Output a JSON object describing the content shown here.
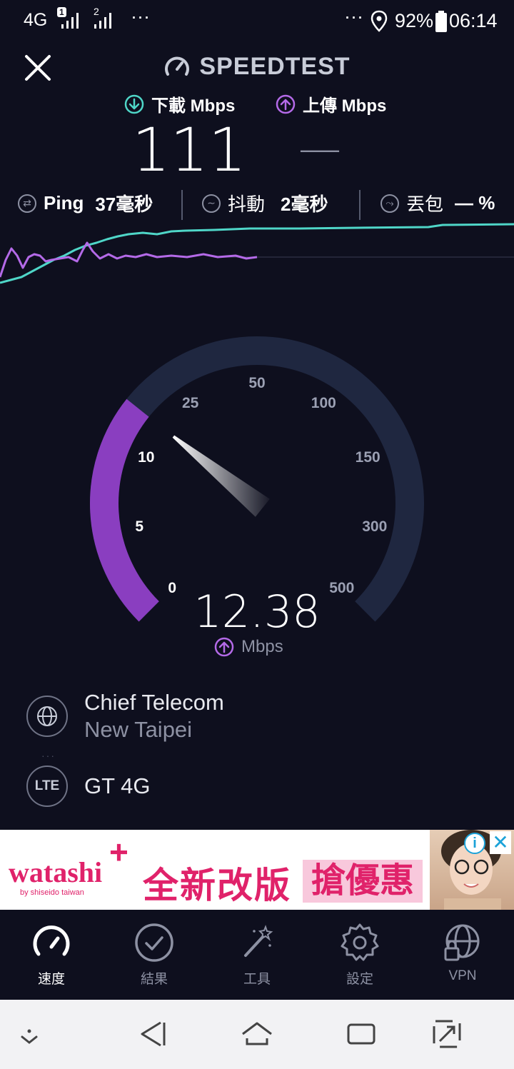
{
  "status_bar": {
    "network": "4G",
    "sim1": "1",
    "sim2": "2",
    "dots_left": "···",
    "dots_right": "···",
    "battery": "92%",
    "time": "06:14"
  },
  "header": {
    "title": "SPEEDTEST"
  },
  "download": {
    "label": "下載 Mbps",
    "value": "111"
  },
  "upload": {
    "label": "上傳 Mbps",
    "value": "—"
  },
  "metrics": {
    "ping_label": "Ping",
    "ping_value": "37毫秒",
    "jitter_label": "抖動",
    "jitter_value": "2毫秒",
    "loss_label": "丟包",
    "loss_value": "— %"
  },
  "gauge": {
    "ticks": [
      {
        "label": "0",
        "active": true
      },
      {
        "label": "5",
        "active": true
      },
      {
        "label": "10",
        "active": true
      },
      {
        "label": "25",
        "active": false
      },
      {
        "label": "50",
        "active": false
      },
      {
        "label": "100",
        "active": false
      },
      {
        "label": "150",
        "active": false
      },
      {
        "label": "300",
        "active": false
      },
      {
        "label": "500",
        "active": false
      }
    ],
    "value": "12.38",
    "unit": "Mbps",
    "level_fraction": 0.31
  },
  "server": {
    "provider": "Chief Telecom",
    "location": "New Taipei"
  },
  "connection": {
    "badge": "LTE",
    "carrier": "GT 4G"
  },
  "ad": {
    "brand": "watashi",
    "brand_sub": "by shiseido taiwan",
    "headline": "全新改版",
    "cta": "搶優惠"
  },
  "nav": [
    {
      "label": "速度",
      "icon": "speedometer-icon",
      "active": true
    },
    {
      "label": "結果",
      "icon": "check-circle-icon",
      "active": false
    },
    {
      "label": "工具",
      "icon": "magic-wand-icon",
      "active": false
    },
    {
      "label": "設定",
      "icon": "gear-icon",
      "active": false
    },
    {
      "label": "VPN",
      "icon": "globe-lock-icon",
      "active": false
    }
  ],
  "colors": {
    "background": "#0e0f1e",
    "download": "#4fd6c8",
    "upload": "#b46ae8",
    "gauge_track": "#1f2740",
    "ad_pink": "#e0226a"
  }
}
